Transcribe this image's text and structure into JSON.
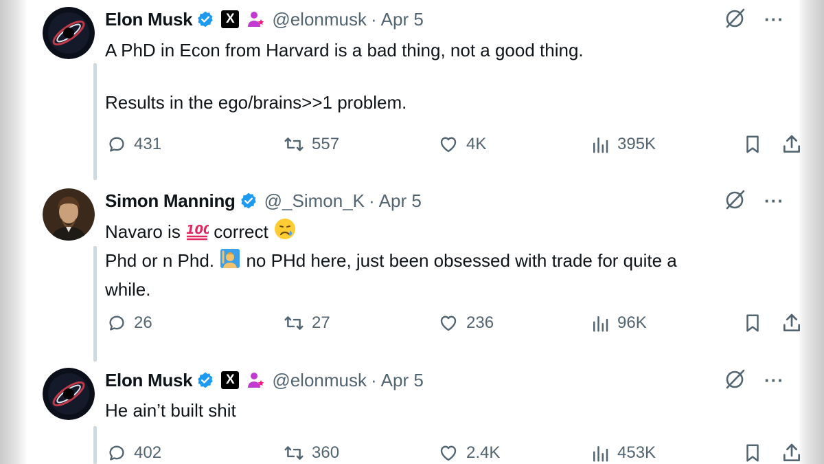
{
  "tweets": [
    {
      "name": "Elon Musk",
      "handle": "@elonmusk",
      "separator": "·",
      "date": "Apr 5",
      "lines": [
        "A PhD in Econ from Harvard is a bad thing, not a good thing.",
        "",
        "Results in the ego/brains>>1 problem."
      ],
      "replies": "431",
      "reposts": "557",
      "likes": "4K",
      "views": "395K",
      "x_badge": "X"
    },
    {
      "name": "Simon Manning",
      "handle": "@_Simon_K",
      "separator": "·",
      "date": "Apr 5",
      "line1_a": "Navaro is ",
      "line1_b": " correct ",
      "line2_a": "Phd or n Phd. ",
      "line2_b": " no PHd here, just been obsessed with trade for quite a",
      "line3": "while.",
      "replies": "26",
      "reposts": "27",
      "likes": "236",
      "views": "96K"
    },
    {
      "name": "Elon Musk",
      "handle": "@elonmusk",
      "separator": "·",
      "date": "Apr 5",
      "lines": [
        "He ain’t built shit"
      ],
      "replies": "402",
      "reposts": "360",
      "likes": "2.4K",
      "views": "453K",
      "x_badge": "X"
    }
  ],
  "more_label": "···",
  "colors": {
    "verified": "#1d9bf0",
    "muted": "#536471",
    "text": "#0f1419",
    "grok_badge": "#f91880"
  }
}
